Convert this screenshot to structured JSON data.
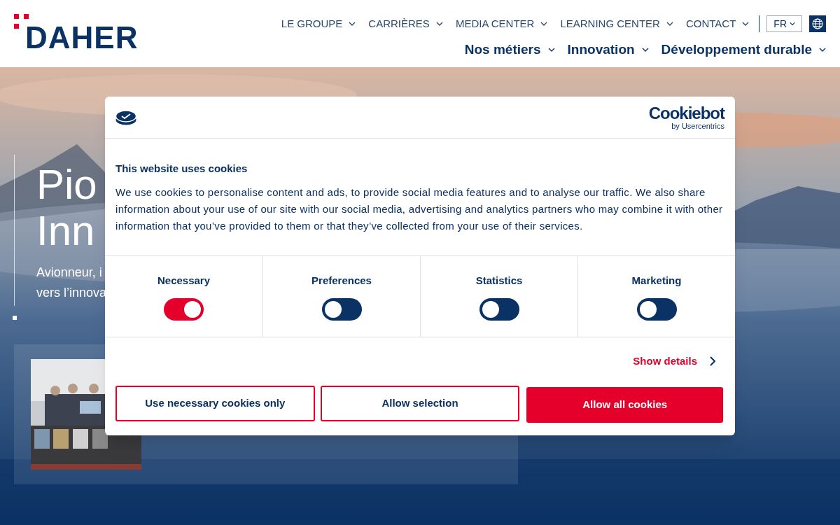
{
  "header": {
    "logo": "DAHER",
    "top_nav": [
      {
        "label": "LE GROUPE"
      },
      {
        "label": "CARRIÈRES"
      },
      {
        "label": "MEDIA CENTER"
      },
      {
        "label": "LEARNING CENTER"
      },
      {
        "label": "CONTACT"
      }
    ],
    "language": "FR",
    "main_nav": [
      {
        "label": "Nos métiers"
      },
      {
        "label": "Innovation"
      },
      {
        "label": "Développement durable"
      }
    ]
  },
  "hero": {
    "title_lines": [
      "Pio",
      "Inn"
    ],
    "subtitle_lines": [
      "Avionneur, i",
      "vers l’innova"
    ]
  },
  "cookie_dialog": {
    "brand": "Cookiebot",
    "brand_sub": "by Usercentrics",
    "title": "This website uses cookies",
    "body": "We use cookies to personalise content and ads, to provide social media features and to analyse our traffic. We also share information about your use of our site with our social media, advertising and analytics partners who may combine it with other information that you’ve provided to them or that they’ve collected from your use of their services.",
    "consents": [
      {
        "label": "Necessary",
        "on": true
      },
      {
        "label": "Preferences",
        "on": false
      },
      {
        "label": "Statistics",
        "on": false
      },
      {
        "label": "Marketing",
        "on": false
      }
    ],
    "details_link": "Show details",
    "buttons": [
      {
        "label": "Use necessary cookies only",
        "kind": "outline"
      },
      {
        "label": "Allow selection",
        "kind": "outline"
      },
      {
        "label": "Allow all cookies",
        "kind": "primary"
      }
    ]
  }
}
